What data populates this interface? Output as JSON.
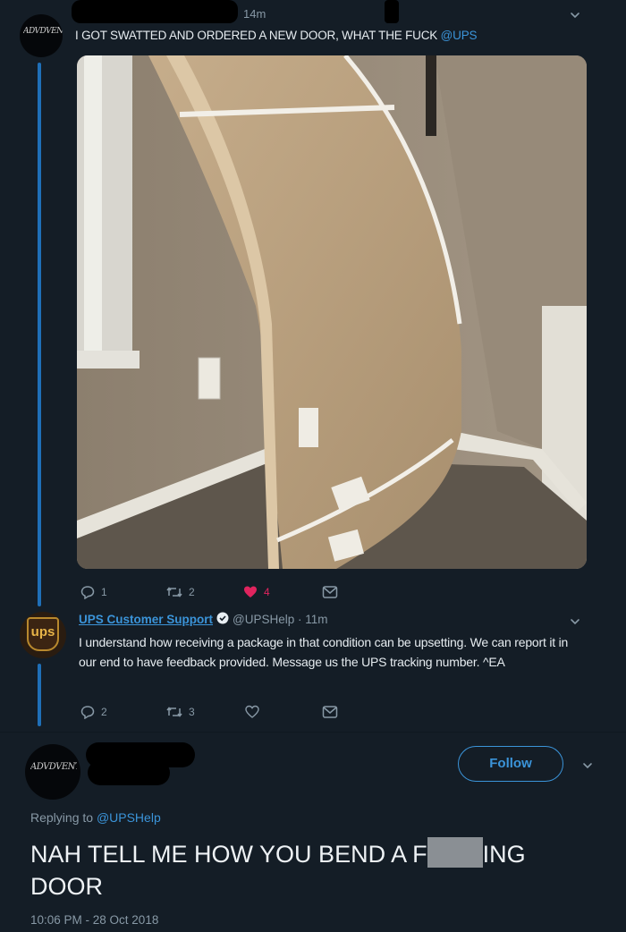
{
  "tweet1": {
    "avatar_text": "ADVDVENTURE",
    "time": "14m",
    "text": "I GOT SWATTED AND ORDERED A NEW DOOR, WHAT THE FUCK ",
    "mention": "@UPS",
    "actions": {
      "replies": "1",
      "retweets": "2",
      "likes": "4"
    },
    "like_color": "#e0245e"
  },
  "reply_ups": {
    "avatar_text": "ups",
    "name": "UPS Customer Support",
    "handle_time": "@UPSHelp · 11m",
    "text": "I understand how receiving a package in that condition can be upsetting. We can report it in our end to have feedback provided. Message us the UPS tracking number. ^EA",
    "actions": {
      "replies": "2",
      "retweets": "3"
    }
  },
  "main_tweet": {
    "avatar_text": "ADVDVENTURE",
    "follow_label": "Follow",
    "replying_to_prefix": "Replying to ",
    "replying_to_handle": "@UPSHelp",
    "text_part1": "NAH TELL ME HOW YOU BEND A F",
    "text_part2": "ING",
    "text_line2": "DOOR",
    "timestamp": "10:06 PM - 28 Oct 2018"
  },
  "colors": {
    "background": "#141d26",
    "accent": "#3b94d9",
    "thread": "#1f6fb7",
    "muted": "#8899a6"
  }
}
